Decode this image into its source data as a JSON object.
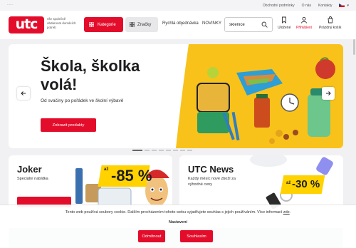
{
  "topbar": {
    "dots": "···",
    "links": [
      "Obchodní podmínky",
      "O nás",
      "Kontakty"
    ],
    "lang": "CZ"
  },
  "header": {
    "logo": "utc",
    "tagline": "vše společně obdarovat domácích potreb",
    "categories_label": "Kategorie",
    "brands_label": "Značky",
    "nav": [
      "Rychlá objednávka",
      "NOVINKY"
    ],
    "search_value": "sklenice",
    "icons": [
      {
        "name": "saved-icon",
        "label": "Uložené"
      },
      {
        "name": "user-icon",
        "label": "Přihlášení"
      },
      {
        "name": "cart-icon",
        "label": "Prázdný košík"
      }
    ]
  },
  "hero": {
    "title": "Škola, školka volá!",
    "subtitle": "Od svаčiny po pořádek ve školní výbavě",
    "button": "Zobrazit produkty",
    "prev_icon": "arrow-left-icon",
    "next_icon": "arrow-right-icon"
  },
  "cards": [
    {
      "title": "Joker",
      "sub": "Speciální nabídka",
      "badge_prefix": "až",
      "badge": "-85 %"
    },
    {
      "title": "UTC News",
      "sub": "Každý měsíc nové zboží za výhodné ceny",
      "badge_prefix": "až",
      "badge": "-30 %"
    }
  ],
  "cookie": {
    "text": "Tento web používá soubory cookie. Dalším procházením tohoto webu vyjadřujete souhlas s jejich používáním.",
    "more": "Více informací",
    "more_link": "zde",
    "settings": "Nastavení",
    "reject": "Odmítnout",
    "accept": "Souhlasím"
  },
  "colors": {
    "brand": "#e30d2b",
    "badge": "#ffd200"
  }
}
